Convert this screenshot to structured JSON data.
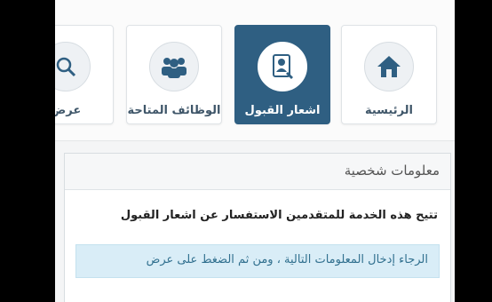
{
  "nav": {
    "items": [
      {
        "label": "الرئيسية",
        "icon": "home-icon"
      },
      {
        "label": "اشعار القبول",
        "icon": "acceptance-notice-icon",
        "active": true
      },
      {
        "label": "الوظائف المتاحة",
        "icon": "available-jobs-icon"
      },
      {
        "label": "عرض",
        "icon": "view-icon"
      }
    ]
  },
  "panel": {
    "title": "معلومات شخصية",
    "description": "تتيح هذه الخدمة للمتقدمين الاستفسار عن اشعار القبول",
    "info": "الرجاء إدخال المعلومات التالية ، ومن ثم الضغط على عرض"
  },
  "colors": {
    "active_tab": "#2f5f82",
    "info_bg": "#d9edf7",
    "info_text": "#31708f"
  }
}
